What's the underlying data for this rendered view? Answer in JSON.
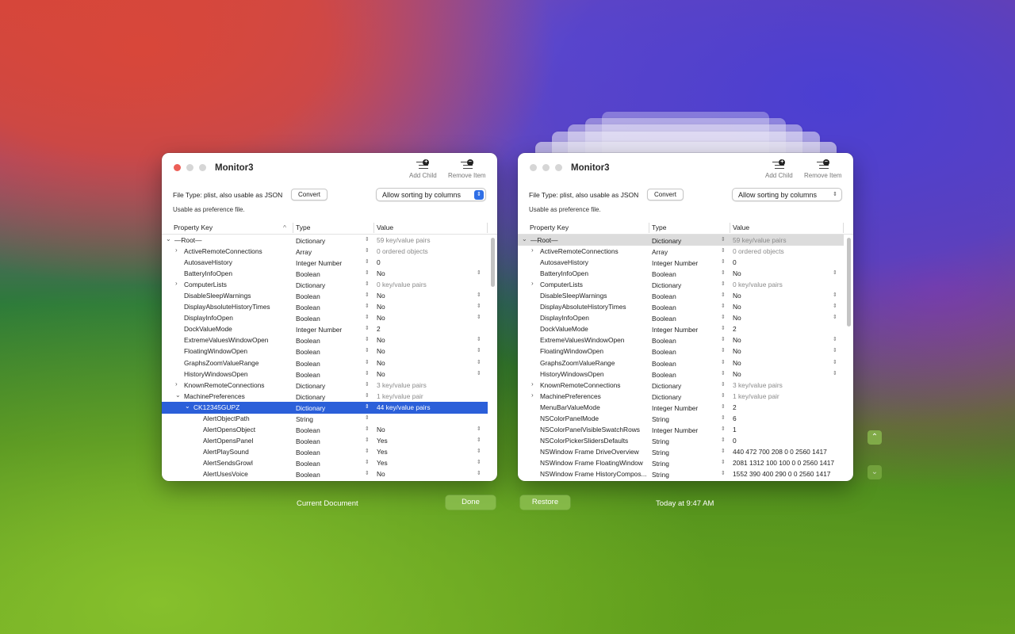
{
  "bottom": {
    "current_document": "Current Document",
    "done": "Done",
    "restore": "Restore",
    "timestamp": "Today at 9:47 AM",
    "up_arrow": "⌃",
    "down_arrow": "⌄"
  },
  "left_window": {
    "title": "Monitor3",
    "add_child": "Add Child",
    "remove_item": "Remove Item",
    "file_type": "File Type: plist, also usable as JSON",
    "convert": "Convert",
    "usable": "Usable as preference file.",
    "sorting": "Allow sorting by columns",
    "columns": {
      "key": "Property Key",
      "type": "Type",
      "value": "Value",
      "sort_arrow": "^"
    },
    "rows": [
      {
        "tw": "⌄",
        "key": "—Root—",
        "type": "Dictionary",
        "value": "59 key/value pairs",
        "muted": true,
        "ind": 0,
        "pop": false
      },
      {
        "tw": "›",
        "key": "ActiveRemoteConnections",
        "type": "Array",
        "value": "0 ordered objects",
        "muted": true,
        "ind": 1,
        "pop": false
      },
      {
        "tw": "",
        "key": "AutosaveHistory",
        "type": "Integer Number",
        "value": "0",
        "muted": false,
        "ind": 1,
        "pop": false
      },
      {
        "tw": "",
        "key": "BatteryInfoOpen",
        "type": "Boolean",
        "value": "No",
        "muted": false,
        "ind": 1,
        "pop": true
      },
      {
        "tw": "›",
        "key": "ComputerLists",
        "type": "Dictionary",
        "value": "0 key/value pairs",
        "muted": true,
        "ind": 1,
        "pop": false
      },
      {
        "tw": "",
        "key": "DisableSleepWarnings",
        "type": "Boolean",
        "value": "No",
        "muted": false,
        "ind": 1,
        "pop": true
      },
      {
        "tw": "",
        "key": "DisplayAbsoluteHistoryTimes",
        "type": "Boolean",
        "value": "No",
        "muted": false,
        "ind": 1,
        "pop": true
      },
      {
        "tw": "",
        "key": "DisplayInfoOpen",
        "type": "Boolean",
        "value": "No",
        "muted": false,
        "ind": 1,
        "pop": true
      },
      {
        "tw": "",
        "key": "DockValueMode",
        "type": "Integer Number",
        "value": "2",
        "muted": false,
        "ind": 1,
        "pop": false
      },
      {
        "tw": "",
        "key": "ExtremeValuesWindowOpen",
        "type": "Boolean",
        "value": "No",
        "muted": false,
        "ind": 1,
        "pop": true
      },
      {
        "tw": "",
        "key": "FloatingWindowOpen",
        "type": "Boolean",
        "value": "No",
        "muted": false,
        "ind": 1,
        "pop": true
      },
      {
        "tw": "",
        "key": "GraphsZoomValueRange",
        "type": "Boolean",
        "value": "No",
        "muted": false,
        "ind": 1,
        "pop": true
      },
      {
        "tw": "",
        "key": "HistoryWindowsOpen",
        "type": "Boolean",
        "value": "No",
        "muted": false,
        "ind": 1,
        "pop": true
      },
      {
        "tw": "›",
        "key": "KnownRemoteConnections",
        "type": "Dictionary",
        "value": "3 key/value pairs",
        "muted": true,
        "ind": 1,
        "pop": false
      },
      {
        "tw": "⌄",
        "key": "MachinePreferences",
        "type": "Dictionary",
        "value": "1 key/value pair",
        "muted": true,
        "ind": 1,
        "pop": false
      },
      {
        "tw": "⌄",
        "key": "CK12345GUPZ",
        "type": "Dictionary",
        "value": "44 key/value pairs",
        "muted": true,
        "ind": 2,
        "pop": false,
        "sel": true
      },
      {
        "tw": "",
        "key": "AlertObjectPath",
        "type": "String",
        "value": "",
        "muted": false,
        "ind": 3,
        "pop": false
      },
      {
        "tw": "",
        "key": "AlertOpensObject",
        "type": "Boolean",
        "value": "No",
        "muted": false,
        "ind": 3,
        "pop": true
      },
      {
        "tw": "",
        "key": "AlertOpensPanel",
        "type": "Boolean",
        "value": "Yes",
        "muted": false,
        "ind": 3,
        "pop": true
      },
      {
        "tw": "",
        "key": "AlertPlaySound",
        "type": "Boolean",
        "value": "Yes",
        "muted": false,
        "ind": 3,
        "pop": true
      },
      {
        "tw": "",
        "key": "AlertSendsGrowl",
        "type": "Boolean",
        "value": "Yes",
        "muted": false,
        "ind": 3,
        "pop": true
      },
      {
        "tw": "",
        "key": "AlertUsesVoice",
        "type": "Boolean",
        "value": "No",
        "muted": false,
        "ind": 3,
        "pop": true
      }
    ]
  },
  "right_window": {
    "title": "Monitor3",
    "add_child": "Add Child",
    "remove_item": "Remove Item",
    "file_type": "File Type: plist, also usable as JSON",
    "convert": "Convert",
    "usable": "Usable as preference file.",
    "sorting": "Allow sorting by columns",
    "columns": {
      "key": "Property Key",
      "type": "Type",
      "value": "Value"
    },
    "rows": [
      {
        "tw": "⌄",
        "key": "—Root—",
        "type": "Dictionary",
        "value": "59 key/value pairs",
        "muted": true,
        "ind": 0,
        "pop": false,
        "hl": true
      },
      {
        "tw": "›",
        "key": "ActiveRemoteConnections",
        "type": "Array",
        "value": "0 ordered objects",
        "muted": true,
        "ind": 1,
        "pop": false
      },
      {
        "tw": "",
        "key": "AutosaveHistory",
        "type": "Integer Number",
        "value": "0",
        "muted": false,
        "ind": 1,
        "pop": false
      },
      {
        "tw": "",
        "key": "BatteryInfoOpen",
        "type": "Boolean",
        "value": "No",
        "muted": false,
        "ind": 1,
        "pop": true
      },
      {
        "tw": "›",
        "key": "ComputerLists",
        "type": "Dictionary",
        "value": "0 key/value pairs",
        "muted": true,
        "ind": 1,
        "pop": false
      },
      {
        "tw": "",
        "key": "DisableSleepWarnings",
        "type": "Boolean",
        "value": "No",
        "muted": false,
        "ind": 1,
        "pop": true
      },
      {
        "tw": "",
        "key": "DisplayAbsoluteHistoryTimes",
        "type": "Boolean",
        "value": "No",
        "muted": false,
        "ind": 1,
        "pop": true
      },
      {
        "tw": "",
        "key": "DisplayInfoOpen",
        "type": "Boolean",
        "value": "No",
        "muted": false,
        "ind": 1,
        "pop": true
      },
      {
        "tw": "",
        "key": "DockValueMode",
        "type": "Integer Number",
        "value": "2",
        "muted": false,
        "ind": 1,
        "pop": false
      },
      {
        "tw": "",
        "key": "ExtremeValuesWindowOpen",
        "type": "Boolean",
        "value": "No",
        "muted": false,
        "ind": 1,
        "pop": true
      },
      {
        "tw": "",
        "key": "FloatingWindowOpen",
        "type": "Boolean",
        "value": "No",
        "muted": false,
        "ind": 1,
        "pop": true
      },
      {
        "tw": "",
        "key": "GraphsZoomValueRange",
        "type": "Boolean",
        "value": "No",
        "muted": false,
        "ind": 1,
        "pop": true
      },
      {
        "tw": "",
        "key": "HistoryWindowsOpen",
        "type": "Boolean",
        "value": "No",
        "muted": false,
        "ind": 1,
        "pop": true
      },
      {
        "tw": "›",
        "key": "KnownRemoteConnections",
        "type": "Dictionary",
        "value": "3 key/value pairs",
        "muted": true,
        "ind": 1,
        "pop": false
      },
      {
        "tw": "›",
        "key": "MachinePreferences",
        "type": "Dictionary",
        "value": "1 key/value pair",
        "muted": true,
        "ind": 1,
        "pop": false
      },
      {
        "tw": "",
        "key": "MenuBarValueMode",
        "type": "Integer Number",
        "value": "2",
        "muted": false,
        "ind": 1,
        "pop": false
      },
      {
        "tw": "",
        "key": "NSColorPanelMode",
        "type": "String",
        "value": "6",
        "muted": false,
        "ind": 1,
        "pop": false
      },
      {
        "tw": "",
        "key": "NSColorPanelVisibleSwatchRows",
        "type": "Integer Number",
        "value": "1",
        "muted": false,
        "ind": 1,
        "pop": false
      },
      {
        "tw": "",
        "key": "NSColorPickerSlidersDefaults",
        "type": "String",
        "value": "0",
        "muted": false,
        "ind": 1,
        "pop": false
      },
      {
        "tw": "",
        "key": "NSWindow Frame DriveOverview",
        "type": "String",
        "value": "440 472 700 208 0 0 2560 1417",
        "muted": false,
        "ind": 1,
        "pop": false
      },
      {
        "tw": "",
        "key": "NSWindow Frame FloatingWindow",
        "type": "String",
        "value": "2081 1312 100 100 0 0 2560 1417",
        "muted": false,
        "ind": 1,
        "pop": false
      },
      {
        "tw": "",
        "key": "NSWindow Frame HistoryCompos...",
        "type": "String",
        "value": "1552 390 400 290 0 0 2560 1417",
        "muted": false,
        "ind": 1,
        "pop": false
      }
    ]
  }
}
